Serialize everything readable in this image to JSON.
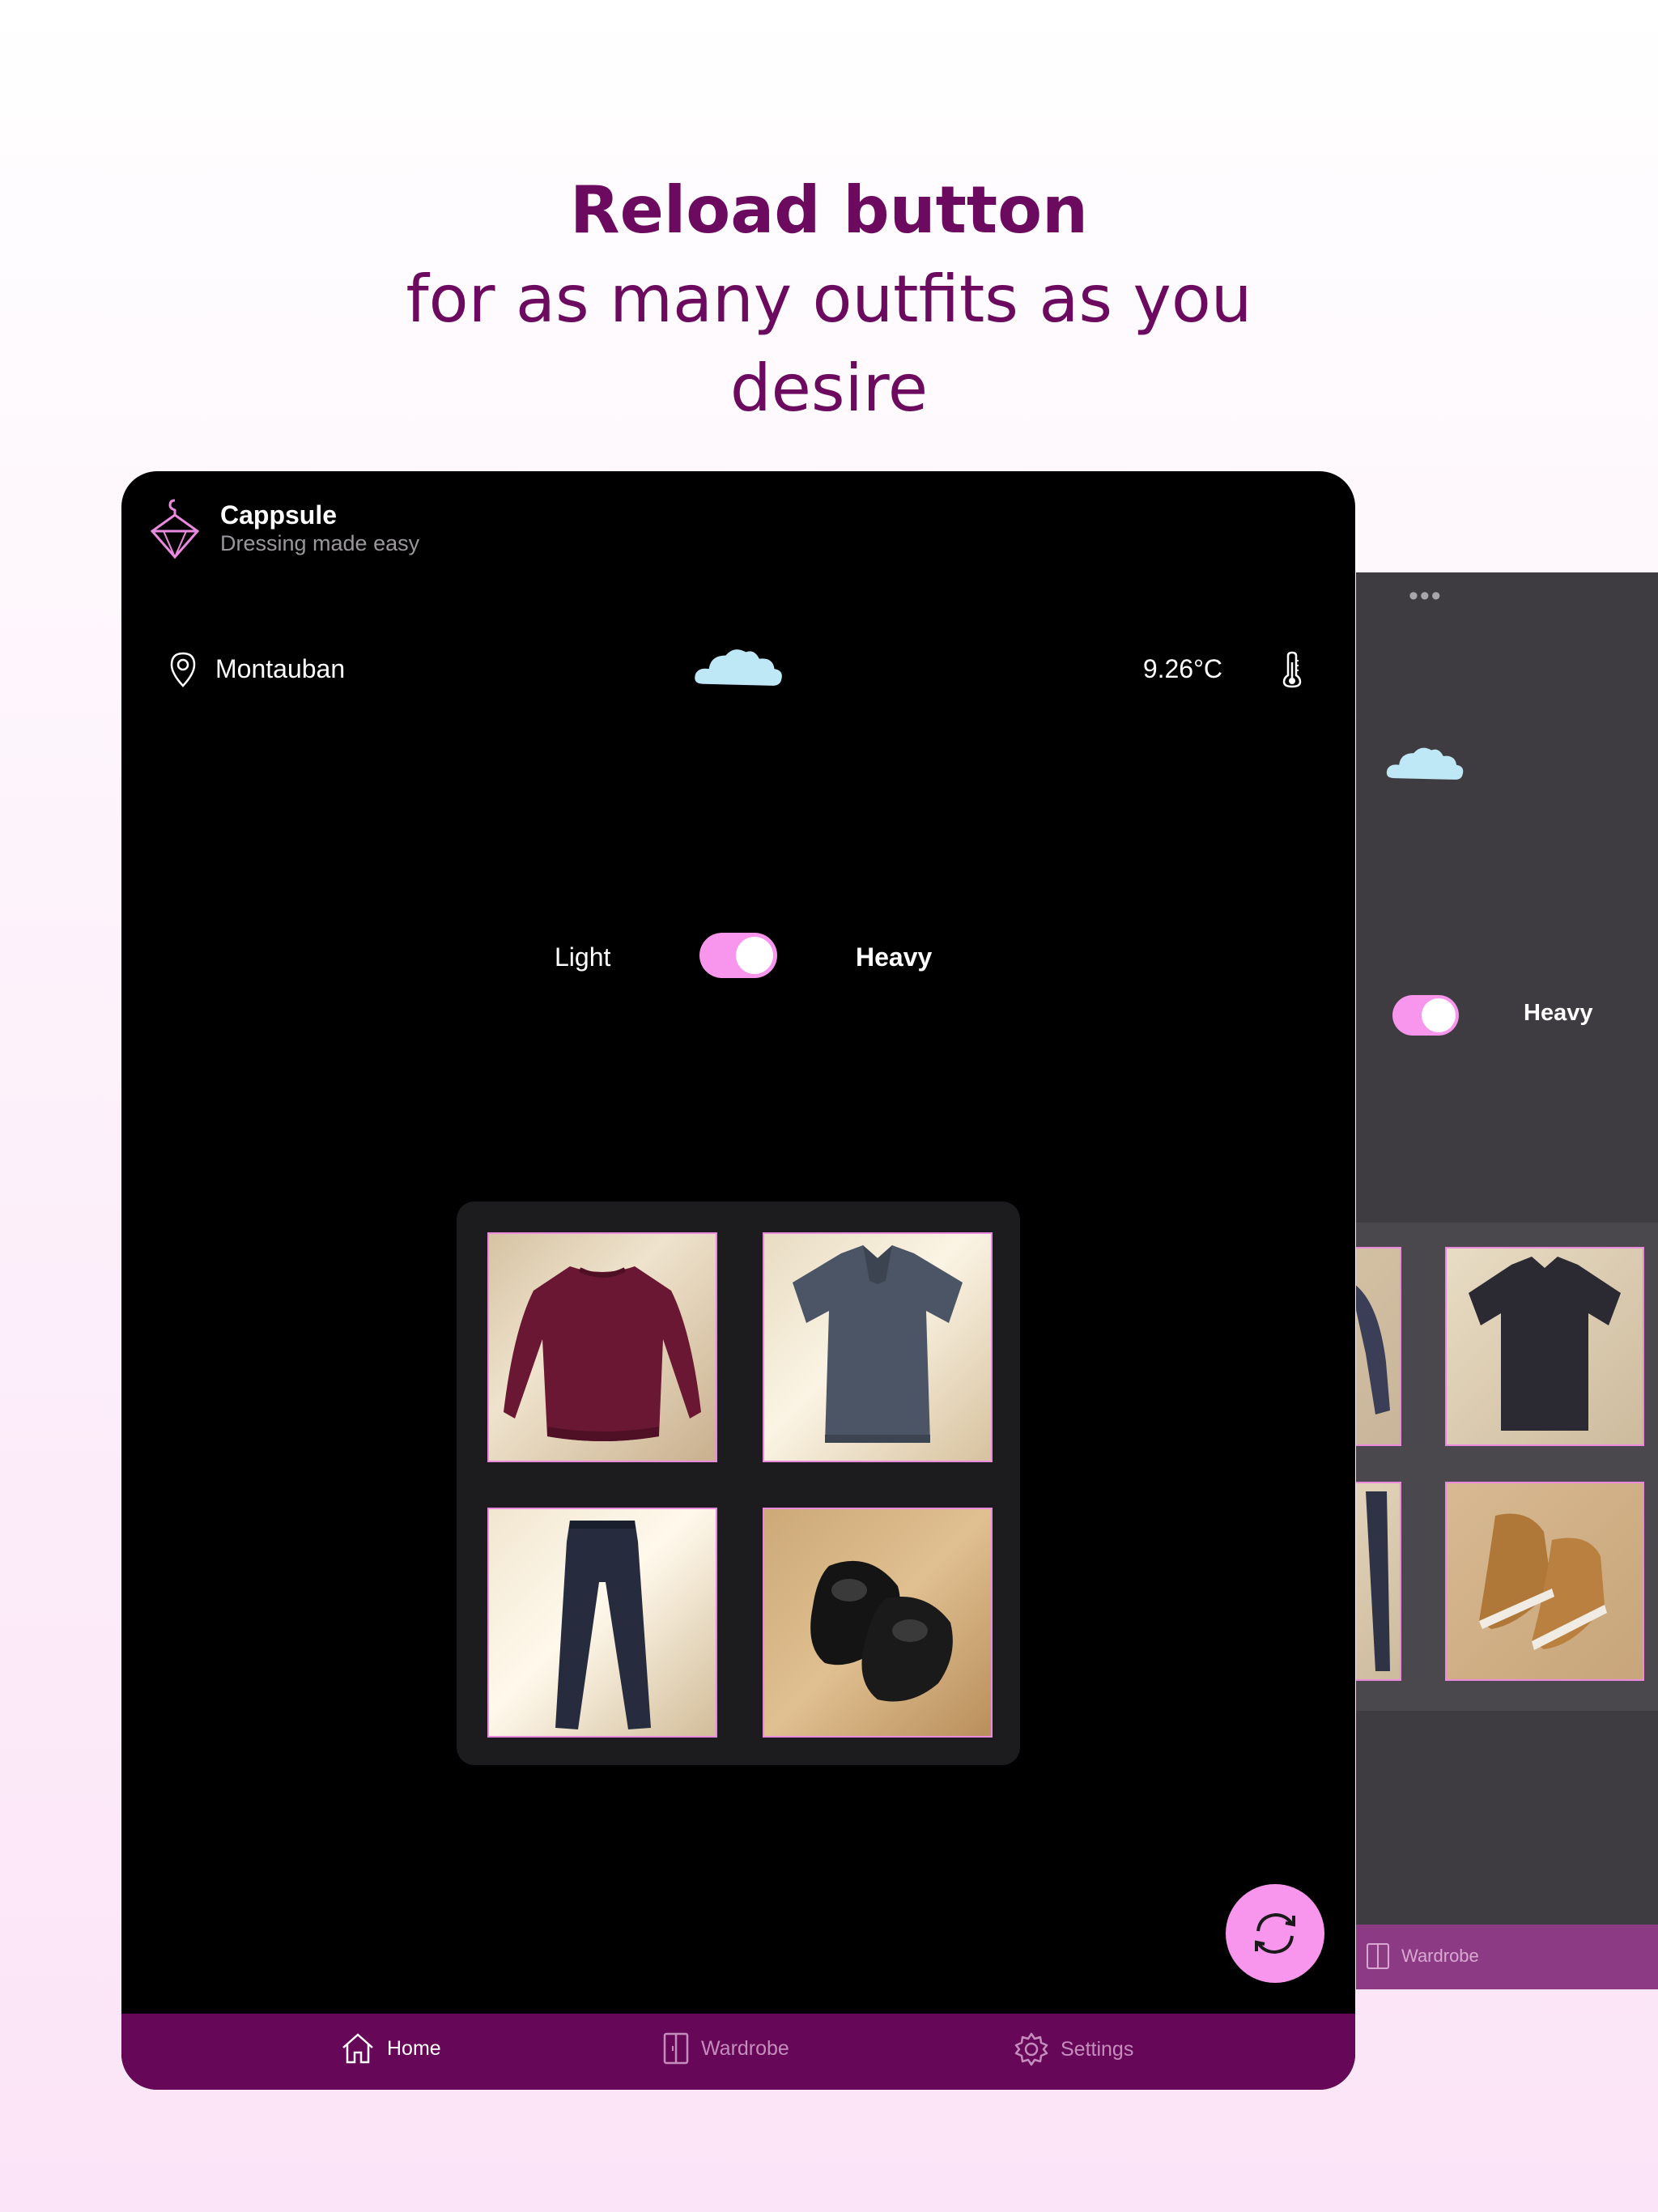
{
  "promo": {
    "headline": "Reload button",
    "subheadline": "for as many outfits as you desire"
  },
  "app": {
    "name": "Cappsule",
    "tagline": "Dressing made easy"
  },
  "weather": {
    "location": "Montauban",
    "temperature": "9.26°C",
    "condition_icon": "cloud-icon"
  },
  "weight_toggle": {
    "left_label": "Light",
    "right_label": "Heavy",
    "selected": "Heavy",
    "is_on": true
  },
  "outfit": {
    "items": [
      {
        "name": "sweater-photo",
        "description": "burgundy sweater"
      },
      {
        "name": "polo-shirt-photo",
        "description": "grey polo shirt"
      },
      {
        "name": "jeans-photo",
        "description": "dark jeans"
      },
      {
        "name": "shoes-photo",
        "description": "black shoes"
      }
    ]
  },
  "reload_button": {
    "icon": "reload-icon"
  },
  "tabbar": {
    "tabs": [
      {
        "label": "Home",
        "icon": "home-icon",
        "active": true
      },
      {
        "label": "Wardrobe",
        "icon": "wardrobe-icon",
        "active": false
      },
      {
        "label": "Settings",
        "icon": "gear-icon",
        "active": false
      }
    ]
  },
  "background_device": {
    "toggle_label": "Heavy",
    "tab_label": "Wardrobe"
  },
  "colors": {
    "brand_purple": "#660757",
    "accent_pink": "#f796ec",
    "headline_purple": "#6b0a5e"
  }
}
